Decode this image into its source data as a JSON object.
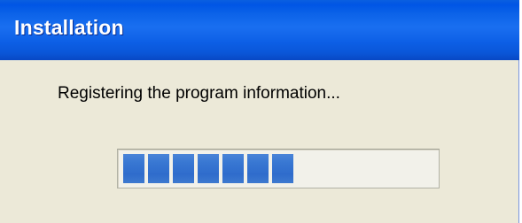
{
  "window": {
    "title": "Installation"
  },
  "main": {
    "status_text": "Registering the program information..."
  },
  "progress": {
    "filled_segments": 7,
    "percent": 55
  },
  "colors": {
    "titlebar": "#0a5fe0",
    "window_background": "#ECE9D8",
    "progress_segment": "#3473cf"
  }
}
